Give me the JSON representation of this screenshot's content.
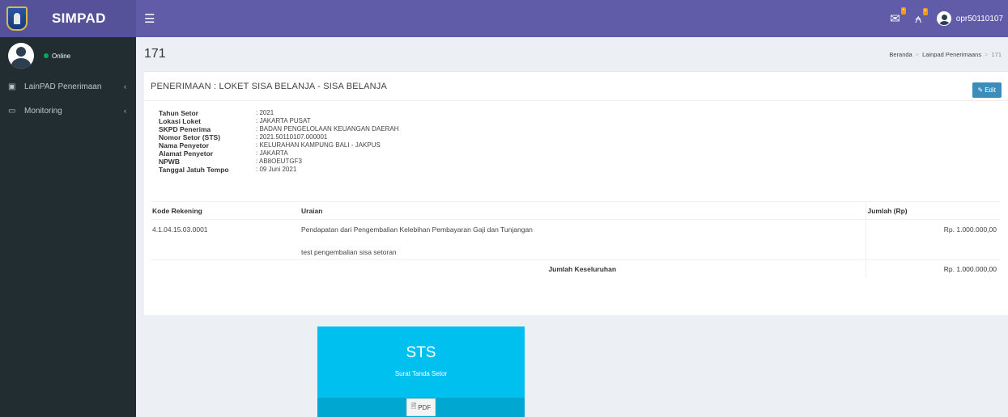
{
  "app": {
    "name": "SIMPAD"
  },
  "header": {
    "user": "opr50110107"
  },
  "sidebar": {
    "status": "Online",
    "items": [
      {
        "label": "LainPAD Penerimaan"
      },
      {
        "label": "Monitoring"
      }
    ]
  },
  "page": {
    "title": "171",
    "breadcrumb": {
      "home": "Beranda",
      "section": "Lainpad Penerimaans",
      "current": "171"
    }
  },
  "box": {
    "title": "PENERIMAAN : LOKET SISA BELANJA - SISA BELANJA",
    "edit_label": "Edit",
    "info": [
      {
        "key": "Tahun Setor",
        "value": ": 2021"
      },
      {
        "key": "Lokasi Loket",
        "value": ": JAKARTA PUSAT"
      },
      {
        "key": "SKPD Penerima",
        "value": ": BADAN PENGELOLAAN KEUANGAN DAERAH"
      },
      {
        "key": "Nomor Setor (STS)",
        "value": ": 2021.50110107.000001"
      },
      {
        "key": "Nama Penyetor",
        "value": ": KELURAHAN KAMPUNG BALI - JAKPUS"
      },
      {
        "key": "Alamat Penyetor",
        "value": ": JAKARTA"
      },
      {
        "key": "NPWB",
        "value": ": AB8OEUTGF3"
      },
      {
        "key": "Tanggal Jatuh Tempo",
        "value": ": 09 Juni 2021"
      }
    ],
    "table": {
      "headers": {
        "kode": "Kode Rekening",
        "uraian": "Uraian",
        "jumlah": "Jumlah (Rp)"
      },
      "row": {
        "kode": "4.1.04.15.03.0001",
        "uraian": "Pendapatan dari Pengembalian Kelebihan Pembayaran Gaji dan Tunjangan",
        "keterangan": "test pengembalian sisa setoran",
        "jumlah": "Rp. 1.000.000,00"
      },
      "total_label": "Jumlah Keseluruhan",
      "total_value": "Rp. 1.000.000,00"
    }
  },
  "sts": {
    "title": "STS",
    "subtitle": "Surat Tanda Setor",
    "pdf_label": "PDF"
  },
  "colors": {
    "header": "#605ca8",
    "sidebar": "#222d32",
    "tile": "#00c0ef",
    "edit_button": "#3c8dbc"
  }
}
